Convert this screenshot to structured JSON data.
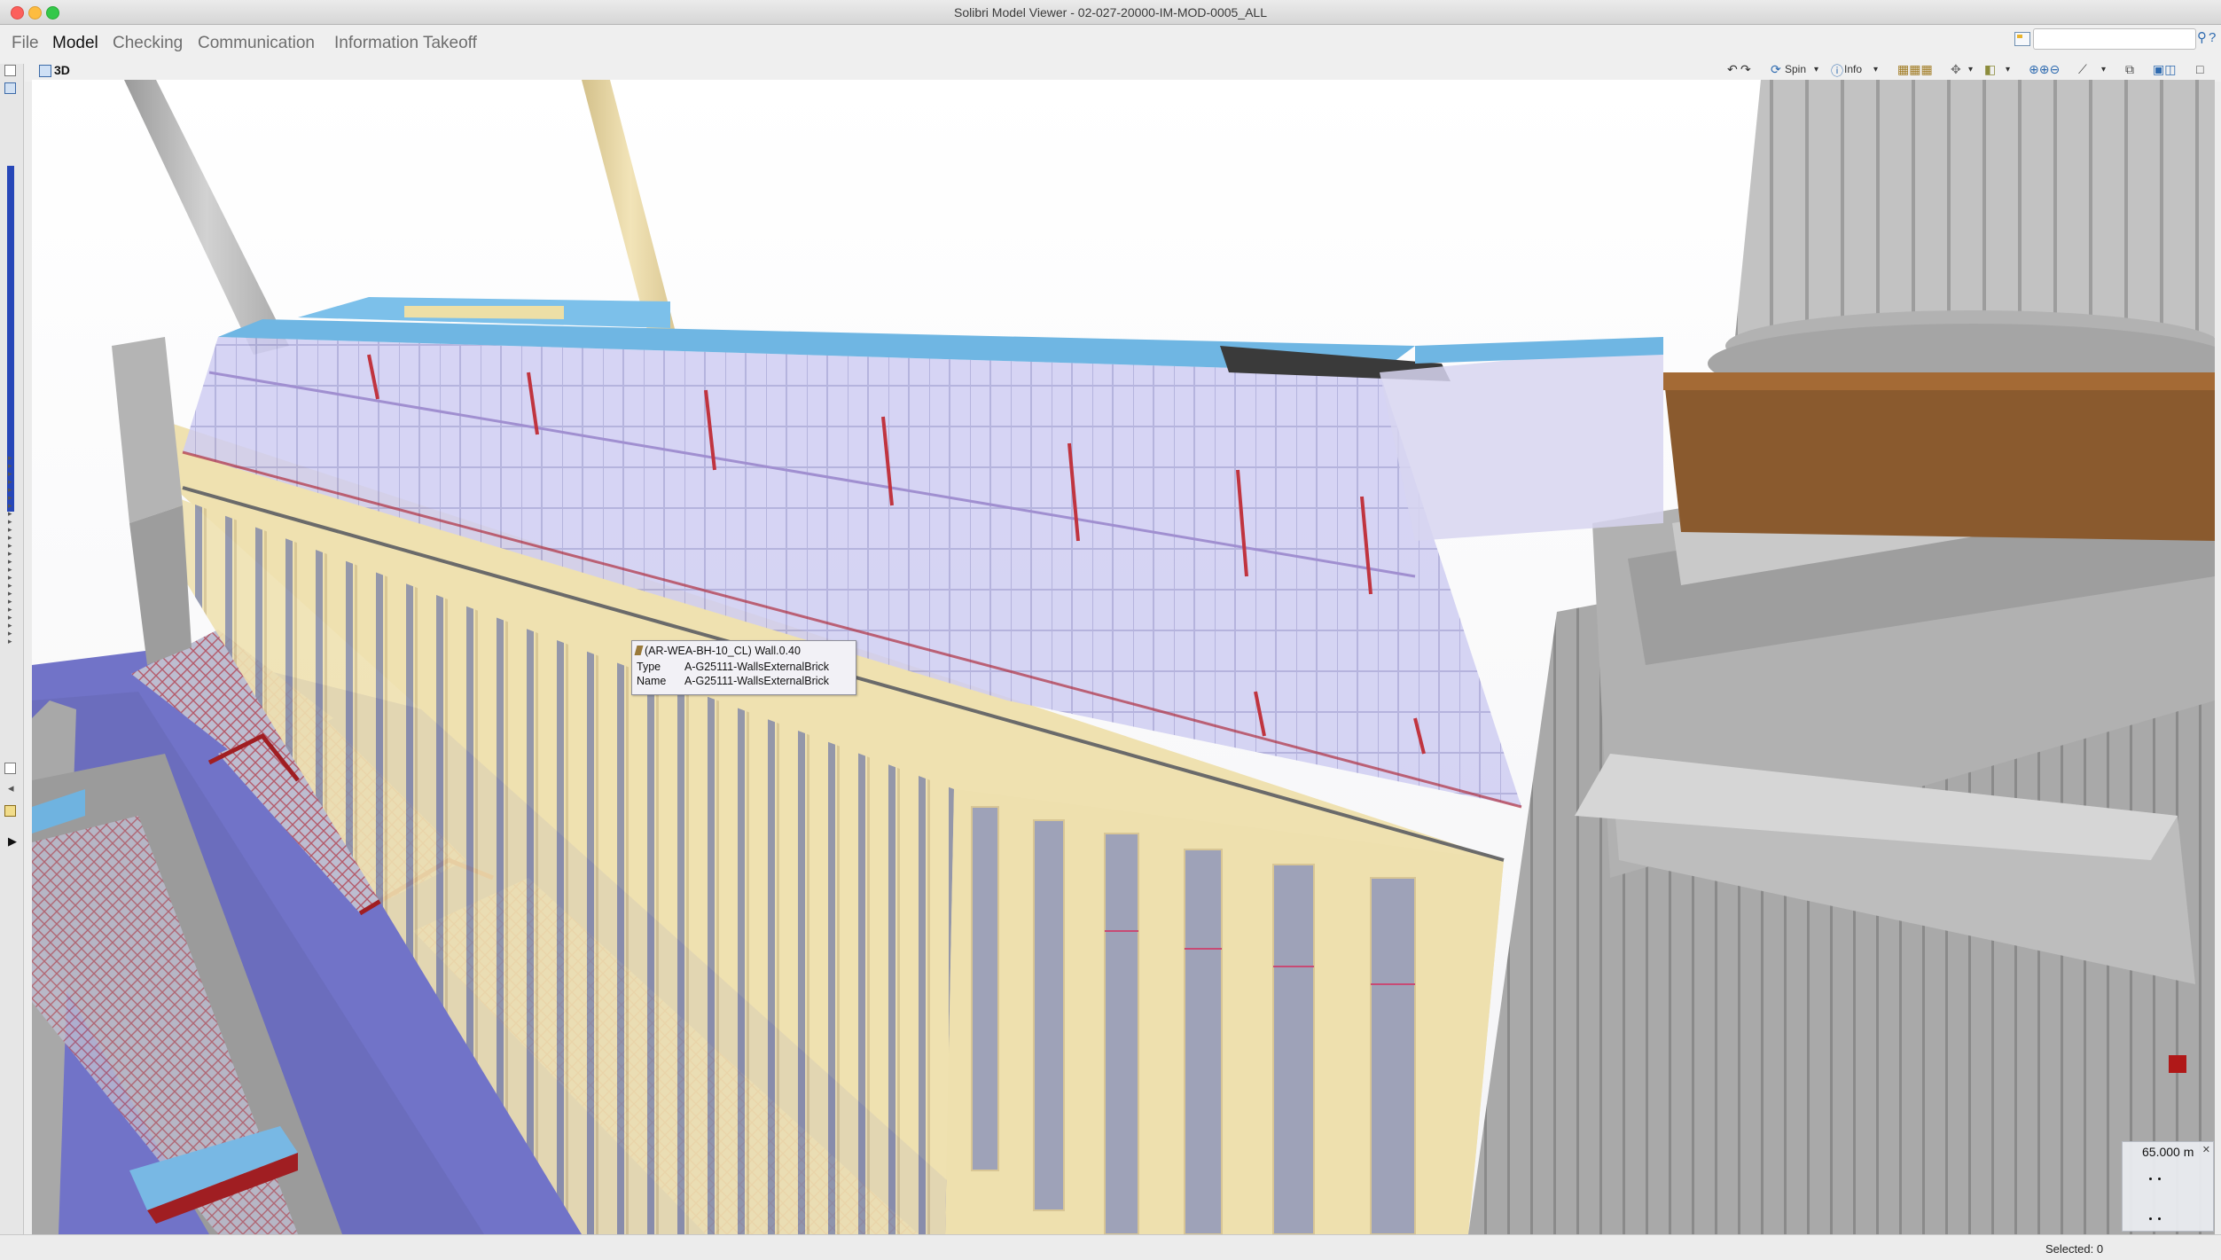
{
  "window": {
    "title": "Solibri Model Viewer - 02-027-20000-IM-MOD-0005_ALL"
  },
  "menu": [
    {
      "label": "File"
    },
    {
      "label": "Model"
    },
    {
      "label": "Checking"
    },
    {
      "label": "Communication"
    },
    {
      "label": "Information Takeoff"
    }
  ],
  "active_menu": "Model",
  "search": {
    "value": ""
  },
  "view": {
    "title": "3D",
    "tools": {
      "spin_label": "Spin",
      "info_label": "Info"
    }
  },
  "tooltip": {
    "title": "(AR-WEA-BH-10_CL) Wall.0.40",
    "rows": [
      {
        "key": "Type",
        "value": "A-G25111-WallsExternalBrick"
      },
      {
        "key": "Name",
        "value": "A-G25111-WallsExternalBrick"
      }
    ]
  },
  "scale": {
    "value": "65.000 m"
  },
  "status": {
    "selected": "Selected: 0"
  },
  "colors": {
    "brick_facade": "#f0e2b2",
    "concrete": "#b9b9b9",
    "glazing": "#c8c6f0",
    "ground": "#7173c8",
    "accent_blue": "#2747b8"
  }
}
